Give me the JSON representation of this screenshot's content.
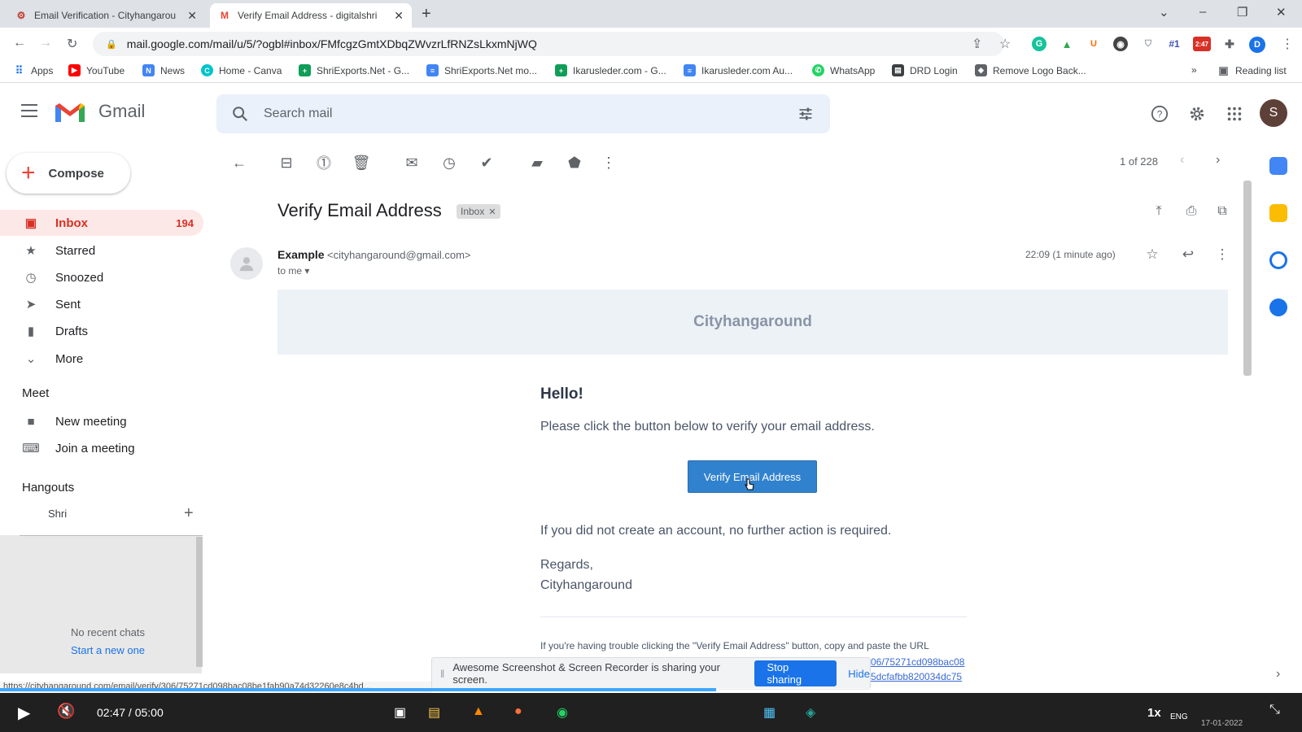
{
  "browser": {
    "tabs": [
      {
        "title": "Email Verification - Cityhangarou",
        "active": false
      },
      {
        "title": "Verify Email Address - digitalshri",
        "active": true
      }
    ],
    "url": "mail.google.com/mail/u/5/?ogbl#inbox/FMfcgzGmtXDbqZWvzrLfRNZsLkxmNjWQ",
    "bookmarks": [
      "Apps",
      "YouTube",
      "News",
      "Home - Canva",
      "ShriExports.Net - G...",
      "ShriExports.Net mo...",
      "Ikarusleder.com - G...",
      "Ikarusleder.com Au...",
      "WhatsApp",
      "DRD Login",
      "Remove Logo Back..."
    ],
    "reading_list": "Reading list",
    "extension_badge": "2:47",
    "profile_initial": "D"
  },
  "gmail": {
    "brand": "Gmail",
    "search_placeholder": "Search mail",
    "account_initial": "S",
    "compose_label": "Compose",
    "nav": [
      {
        "label": "Inbox",
        "count": "194",
        "icon": "inbox-icon"
      },
      {
        "label": "Starred",
        "count": "",
        "icon": "star-icon"
      },
      {
        "label": "Snoozed",
        "count": "",
        "icon": "clock-icon"
      },
      {
        "label": "Sent",
        "count": "",
        "icon": "send-icon"
      },
      {
        "label": "Drafts",
        "count": "",
        "icon": "draft-icon"
      },
      {
        "label": "More",
        "count": "",
        "icon": "chevron-down-icon"
      }
    ],
    "meet_heading": "Meet",
    "meet_items": [
      {
        "label": "New meeting",
        "icon": "video-camera-icon"
      },
      {
        "label": "Join a meeting",
        "icon": "keyboard-icon"
      }
    ],
    "hangouts_heading": "Hangouts",
    "hangouts_user": "Shri",
    "no_recent_chats": "No recent chats",
    "start_new": "Start a new one"
  },
  "mail": {
    "pager": "1 of 228",
    "subject": "Verify Email Address",
    "label": "Inbox",
    "sender_name": "Example",
    "sender_email": "<cityhangaround@gmail.com>",
    "to": "to me",
    "time": "22:09 (1 minute ago)",
    "banner": "Cityhangaround",
    "greeting": "Hello!",
    "instruction": "Please click the button below to verify your email address.",
    "button": "Verify Email Address",
    "no_action": "If you did not create an account, no further action is required.",
    "regards": "Regards,",
    "signature": "Cityhangaround",
    "trouble_text": "If you're having trouble clicking the \"Verify Email Address\" button, copy and paste the URL",
    "url_fragment_1": "06/75271cd098bac08",
    "url_fragment_2": "5dcfafbb820034dc75"
  },
  "share_bar": {
    "message": "Awesome Screenshot & Screen Recorder is sharing your screen.",
    "stop": "Stop sharing",
    "hide": "Hide"
  },
  "status_url": "https://cityhangaround.com/email/verify/306/75271cd098bac08be1fab90a74d32260e8c4bd...",
  "player": {
    "time": "02:47 / 05:00",
    "progress": 0.557,
    "speed": "1x",
    "lang": "ENG",
    "date": "17-01-2022"
  },
  "colors": {
    "gmail_red": "#ea4335",
    "inbox_active_bg": "#fce8e6",
    "verify_button": "#3182ce",
    "stop_button": "#1a73e8"
  }
}
